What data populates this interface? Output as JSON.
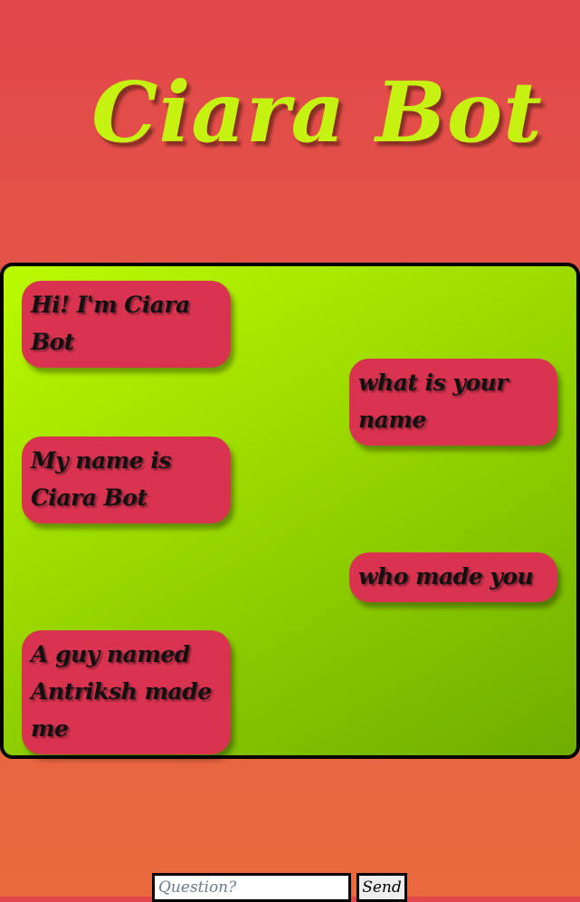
{
  "app": {
    "title": "Ciara Bot"
  },
  "chat": {
    "messages": [
      {
        "sender": "bot",
        "text": "Hi! I'm Ciara Bot"
      },
      {
        "sender": "user",
        "text": "what is your name"
      },
      {
        "sender": "bot",
        "text": "My name is Ciara Bot"
      },
      {
        "sender": "user",
        "text": "who made you"
      },
      {
        "sender": "bot",
        "text": "A guy named Antriksh made me"
      }
    ]
  },
  "composer": {
    "placeholder": "Question?",
    "value": "",
    "send_label": "Send"
  },
  "colors": {
    "title": "#c6f211",
    "bubble": "#d93350",
    "chat_bg_start": "#bbfb00",
    "chat_bg_end": "#6fad00",
    "page_bg_top": "#e2474b",
    "page_bg_bottom": "#e96a3e"
  }
}
